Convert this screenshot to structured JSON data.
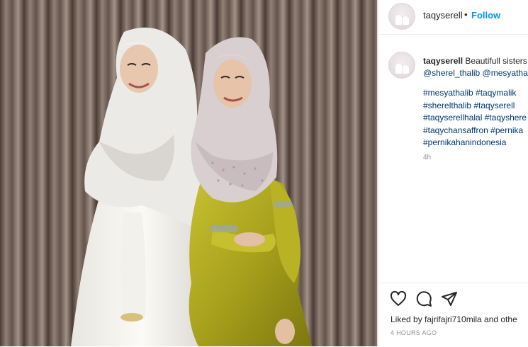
{
  "post": {
    "username": "taqyserell",
    "follow_label": "Follow",
    "separator": "•",
    "caption_text": "Beautifull sisters",
    "mentions": "@sherel_thalib @mesyatha",
    "hashtags": [
      "#mesyathalib #taqymalik",
      "#sherelthalib #taqyserell",
      "#taqyserellhalal #taqyshere",
      "#taqychansaffron #pernika",
      "#pernikahanindonesia"
    ],
    "relative_time": "4h",
    "liked_by": "Liked by fajrifajri710mila and othe",
    "timestamp": "4 HOURS AGO"
  },
  "icons": {
    "like": "heart-icon",
    "comment": "comment-icon",
    "share": "paper-plane-icon"
  },
  "colors": {
    "accent": "#0095f6",
    "link": "#00376b",
    "text": "#262626",
    "muted": "#8e8e8e",
    "border": "#efefef"
  }
}
